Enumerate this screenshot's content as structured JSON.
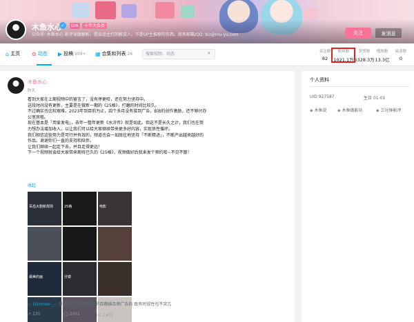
{
  "profile": {
    "name": "木鱼水心",
    "level": "LV6",
    "vip": "十年大会员",
    "signature": "公众号: 木鱼水心 影评深度解析，是出品主打的解说人，不是UP主推荐的东西。商务邮箱/QQ: biz@mu-yu.com",
    "follow_label": "关注",
    "message_label": "发消息"
  },
  "nav": {
    "items": [
      {
        "label": "主页",
        "icon": "home-icon",
        "count": ""
      },
      {
        "label": "动态",
        "icon": "dynamic-icon",
        "count": ""
      },
      {
        "label": "投稿",
        "icon": "video-icon",
        "count": "999+"
      },
      {
        "label": "合集和列表",
        "icon": "collection-icon",
        "count": "26"
      }
    ],
    "active": "动态",
    "search_placeholder": "搜索视频、动态"
  },
  "stats": [
    {
      "label": "关注数",
      "value": "82"
    },
    {
      "label": "粉丝数",
      "value": "1021.1万"
    },
    {
      "label": "获赞数",
      "value": "6328.3万"
    },
    {
      "label": "播放数",
      "value": "13.3亿"
    },
    {
      "label": "阅读数",
      "value": "0"
    }
  ],
  "post": {
    "author": "木鱼水心",
    "time": "昨天",
    "paragraphs": [
      "看到大家在上期视频中的留言了，没有停更哈，还在努力坚持中。",
      "这段时间没有更新，主要是在做新一期的《25格》，打磨的时间比较久。",
      "不过确实也比较艰难，2023年到目前为止，四个多月没有接到广告，B站的创作激励，还不够付办公室房租。",
      "现在基本是「用爱发电」，去年一整年更新《水浒传》就是如此。但这不是长久之计，我们也在努力想办法增加收入，以让我们可以给大家继续带来更多好内容，实现良性循环。",
      "我们相信这些努力是可行并有效的，频道也会一如既往地坚持「不断精进」，不断产出越来越好的作品。谢谢你们一直的支持和陪伴。",
      "让我们继续一起走下去，并且走得更远！",
      "下一个视频就会给大家带来期待已久的《25格》，视频做好后我来发个预约哈~不见不散！"
    ],
    "collapse_label": "收起",
    "thumbnails": [
      {
        "caption": "百岳大剧新规则",
        "color": "#2b2f38"
      },
      {
        "caption": "25格",
        "color": "#1a1a1c"
      },
      {
        "caption": "电影",
        "color": "#3a3436"
      },
      {
        "caption": "",
        "color": "#4a4f58"
      },
      {
        "caption": "",
        "color": "#171819"
      },
      {
        "caption": "",
        "color": "#55403a"
      },
      {
        "caption": "最美的画",
        "color": "#1f2a3a"
      },
      {
        "caption": "分镜",
        "color": "#2c2c30"
      },
      {
        "caption": "",
        "color": "#3b2f2a"
      },
      {
        "caption": "",
        "color": "#2a3a48"
      },
      {
        "caption": "",
        "color": "#5a5560"
      },
      {
        "caption": "",
        "color": "#c8c4c0"
      }
    ],
    "comment_user": "Glimmer-_-:",
    "comment_text": "想把非凡懂视频那个节目都插合频广告的 既有时效性也不突兀",
    "forward_count": "135",
    "comment_count": "2001",
    "like_count": "2.6万"
  },
  "sidebar": {
    "title": "个人资料",
    "uid_label": "UID",
    "uid": "927587",
    "birthday_label": "生日",
    "birthday": "01-01",
    "tags": [
      "木鱼说",
      "木鱼做影坊",
      "三分钟影评"
    ]
  }
}
